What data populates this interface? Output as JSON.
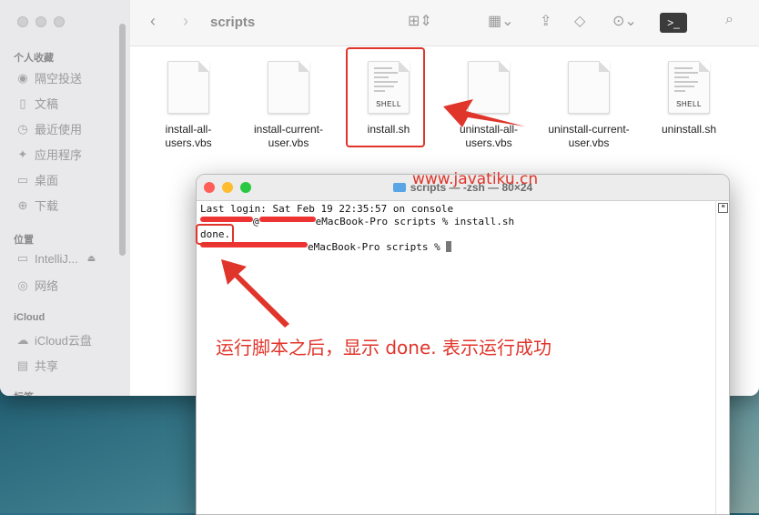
{
  "finder": {
    "title": "scripts",
    "sidebar": {
      "favorites_header": "个人收藏",
      "favorites": [
        {
          "label": "隔空投送",
          "icon": "airdrop-icon"
        },
        {
          "label": "文稿",
          "icon": "document-icon"
        },
        {
          "label": "最近使用",
          "icon": "clock-icon"
        },
        {
          "label": "应用程序",
          "icon": "apps-icon"
        },
        {
          "label": "桌面",
          "icon": "desktop-icon"
        },
        {
          "label": "下载",
          "icon": "download-icon"
        }
      ],
      "locations_header": "位置",
      "locations": [
        {
          "label": "IntelliJ...",
          "icon": "disk-icon"
        },
        {
          "label": "网络",
          "icon": "network-icon"
        }
      ],
      "icloud_header": "iCloud",
      "icloud": [
        {
          "label": "iCloud云盘",
          "icon": "cloud-icon"
        },
        {
          "label": "共享",
          "icon": "shared-folder-icon"
        }
      ],
      "tags_header": "标签"
    },
    "files": [
      {
        "name": "install-all-users.vbs",
        "line1": "install-all-",
        "line2": "users.vbs",
        "kind": "document"
      },
      {
        "name": "install-current-user.vbs",
        "line1": "install-current-",
        "line2": "user.vbs",
        "kind": "document"
      },
      {
        "name": "install.sh",
        "line1": "install.sh",
        "line2": "",
        "kind": "shell",
        "badge": "SHELL"
      },
      {
        "name": "uninstall-all-users.vbs",
        "line1": "uninstall-all-",
        "line2": "users.vbs",
        "kind": "document"
      },
      {
        "name": "uninstall-current-user.vbs",
        "line1": "uninstall-current-",
        "line2": "user.vbs",
        "kind": "document"
      },
      {
        "name": "uninstall.sh",
        "line1": "uninstall.sh",
        "line2": "",
        "kind": "shell",
        "badge": "SHELL"
      }
    ]
  },
  "terminal": {
    "title": "scripts — -zsh — 80×24",
    "lines": {
      "login": "Last login: Sat Feb 19 22:35:57 on console",
      "prompt1_at": "@",
      "prompt1_rest": "eMacBook-Pro scripts % install.sh",
      "output": "done.",
      "prompt2_rest": "eMacBook-Pro scripts % "
    }
  },
  "watermark": "www.javatiku.cn",
  "annotation": "运行脚本之后，显示 done. 表示运行成功",
  "colors": {
    "annotation_red": "#e0352b",
    "close": "#ff5f57",
    "minimize": "#febc2e",
    "zoom": "#28c840"
  }
}
